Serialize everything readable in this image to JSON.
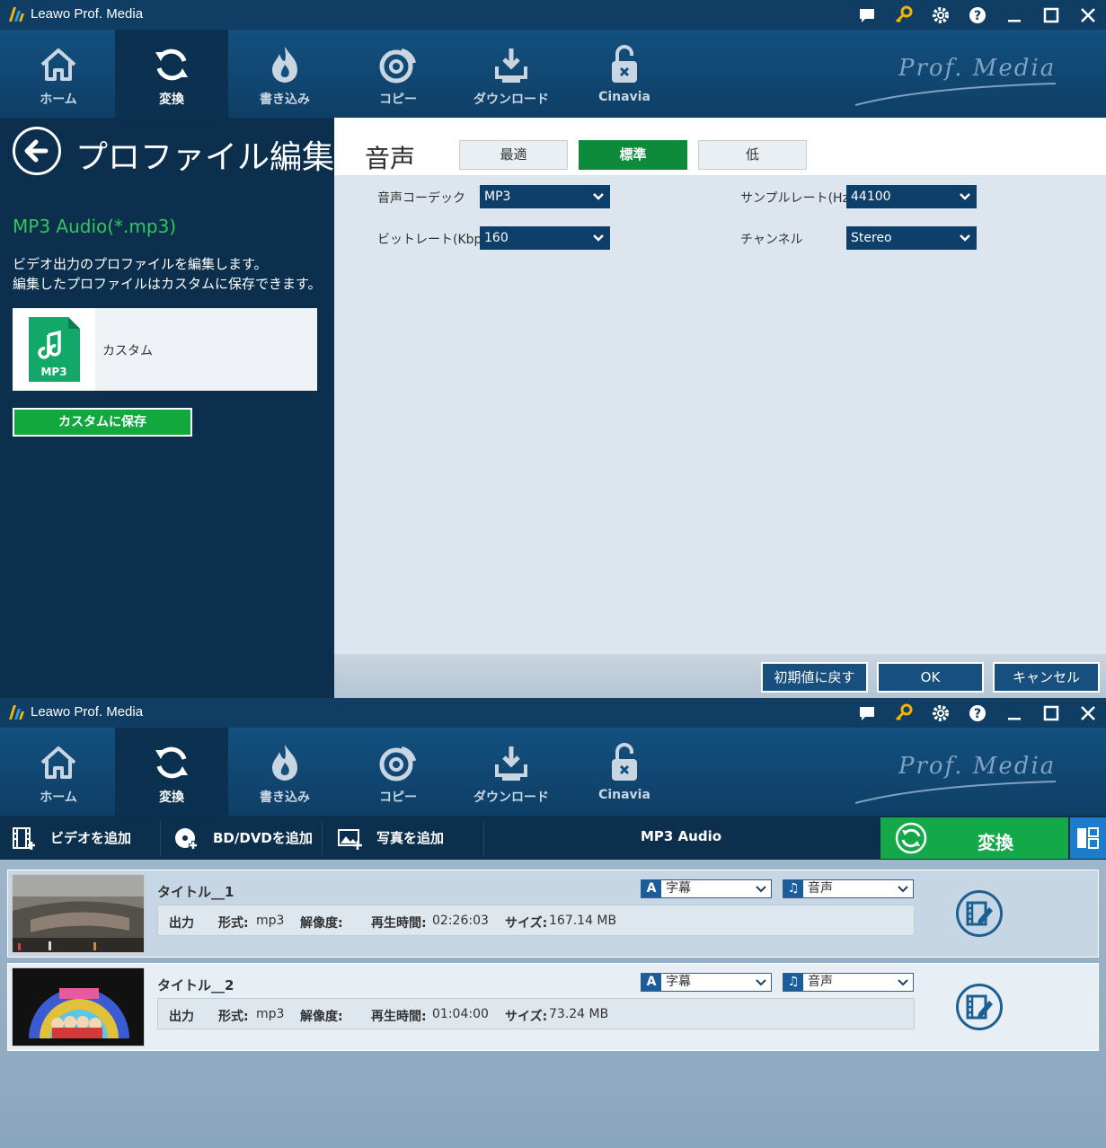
{
  "app": {
    "title": "Leawo Prof. Media",
    "brand": "Prof. Media"
  },
  "nav": [
    {
      "label": "ホーム"
    },
    {
      "label": "変換"
    },
    {
      "label": "書き込み"
    },
    {
      "label": "コピー"
    },
    {
      "label": "ダウンロード"
    },
    {
      "label": "Cinavia"
    }
  ],
  "profile_editor": {
    "title": "プロファイル編集",
    "format_name": "MP3 Audio(*.mp3)",
    "description_line1": "ビデオ出力のプロファイルを編集します。",
    "description_line2": "編集したプロファイルはカスタムに保存できます。",
    "custom_card": {
      "badge": "MP3",
      "label": "カスタム"
    },
    "save_custom_label": "カスタムに保存",
    "section_title": "音声",
    "quality_tabs": [
      {
        "label": "最適"
      },
      {
        "label": "標準",
        "selected": true
      },
      {
        "label": "低"
      }
    ],
    "fields": {
      "codec": {
        "label": "音声コーデック",
        "value": "MP3"
      },
      "bitrate": {
        "label": "ビットレート(Kbps)",
        "value": "160"
      },
      "sample_rate": {
        "label": "サンプルレート(Hz)",
        "value": "44100"
      },
      "channel": {
        "label": "チャンネル",
        "value": "Stereo"
      }
    },
    "footer": {
      "reset": "初期値に戻す",
      "ok": "OK",
      "cancel": "キャンセル"
    }
  },
  "convert_view": {
    "add_video": "ビデオを追加",
    "add_bd": "BD/DVDを追加",
    "add_photo": "写真を追加",
    "output_format": "MP3 Audio",
    "convert_label": "変換",
    "items": [
      {
        "title": "タイトル__1",
        "output_label": "出力",
        "format_label": "形式:",
        "format": "mp3",
        "resolution_label": "解像度:",
        "duration_label": "再生時間:",
        "duration": "02:26:03",
        "size_label": "サイズ:",
        "size": "167.14 MB",
        "subtitle": "字幕",
        "audio": "音声"
      },
      {
        "title": "タイトル__2",
        "output_label": "出力",
        "format_label": "形式:",
        "format": "mp3",
        "resolution_label": "解像度:",
        "duration_label": "再生時間:",
        "duration": "01:04:00",
        "size_label": "サイズ:",
        "size": "73.24 MB",
        "subtitle": "字幕",
        "audio": "音声"
      }
    ]
  },
  "colors": {
    "accent_green": "#14a948",
    "header_blue": "#0f3d63",
    "select_blue": "#0e3f6b"
  }
}
